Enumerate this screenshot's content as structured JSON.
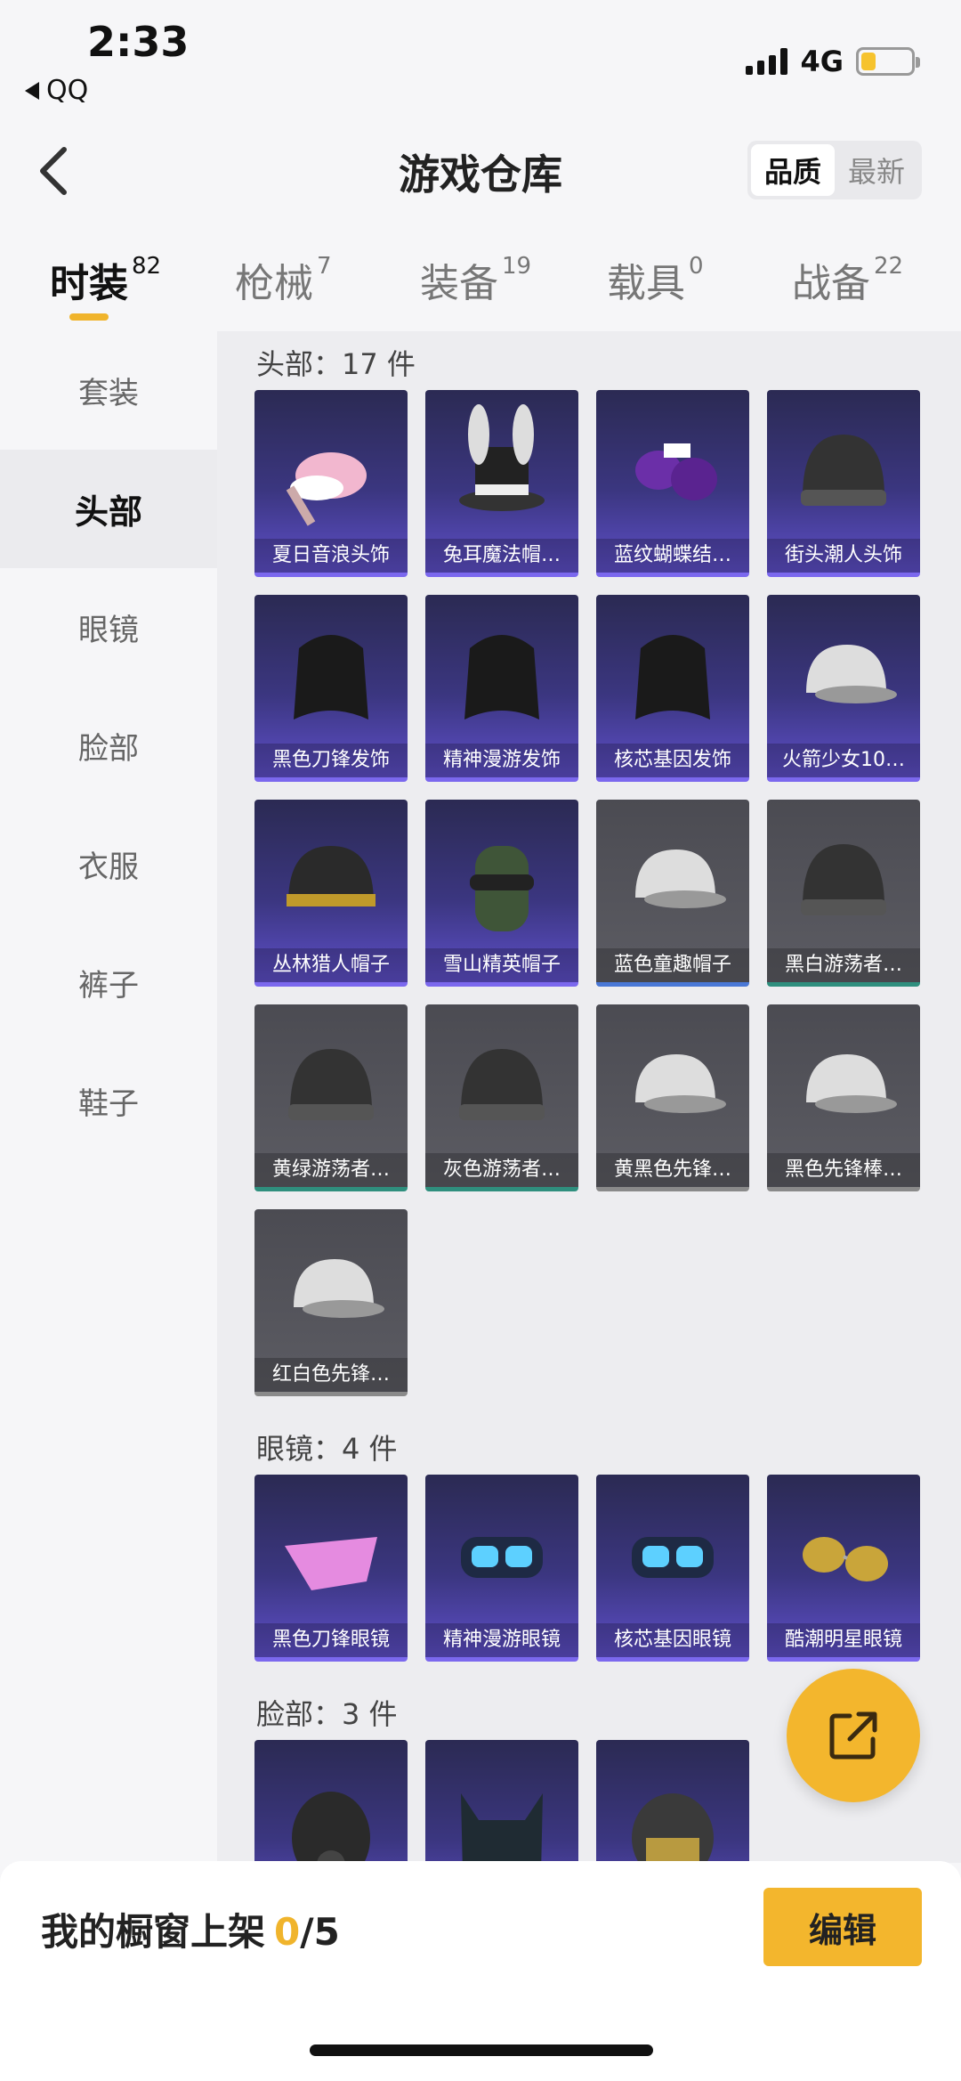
{
  "status_bar": {
    "time": "2:33",
    "back_app": "QQ",
    "network": "4G",
    "battery_level": 0.3
  },
  "nav": {
    "title": "游戏仓库",
    "sort_options": [
      "品质",
      "最新"
    ],
    "sort_active": "品质"
  },
  "categories": [
    {
      "label": "时装",
      "count": "82",
      "active": true
    },
    {
      "label": "枪械",
      "count": "7",
      "active": false
    },
    {
      "label": "装备",
      "count": "19",
      "active": false
    },
    {
      "label": "载具",
      "count": "0",
      "active": false
    },
    {
      "label": "战备",
      "count": "22",
      "active": false
    }
  ],
  "sidebar": {
    "items": [
      {
        "label": "套装"
      },
      {
        "label": "头部"
      },
      {
        "label": "眼镜"
      },
      {
        "label": "脸部"
      },
      {
        "label": "衣服"
      },
      {
        "label": "裤子"
      },
      {
        "label": "鞋子"
      }
    ],
    "active_index": 1
  },
  "sections": [
    {
      "title": "头部：17 件",
      "items": [
        {
          "name": "夏日音浪头饰",
          "rarity": "purple",
          "icon": "hat-icon"
        },
        {
          "name": "兔耳魔法帽…",
          "rarity": "purple",
          "icon": "top-hat-icon"
        },
        {
          "name": "蓝纹蝴蝶结…",
          "rarity": "purple",
          "icon": "bow-icon"
        },
        {
          "name": "街头潮人头饰",
          "rarity": "purple",
          "icon": "beanie-icon"
        },
        {
          "name": "黑色刀锋发饰",
          "rarity": "purple",
          "icon": "hair-icon"
        },
        {
          "name": "精神漫游发饰",
          "rarity": "purple",
          "icon": "hair-icon"
        },
        {
          "name": "核芯基因发饰",
          "rarity": "purple",
          "icon": "hair-icon"
        },
        {
          "name": "火箭少女10…",
          "rarity": "purple",
          "icon": "cap-icon"
        },
        {
          "name": "丛林猎人帽子",
          "rarity": "purple",
          "icon": "helmet-icon"
        },
        {
          "name": "雪山精英帽子",
          "rarity": "purple",
          "icon": "mask-hat-icon"
        },
        {
          "name": "蓝色童趣帽子",
          "rarity": "blue",
          "icon": "cap-icon"
        },
        {
          "name": "黑白游荡者…",
          "rarity": "teal",
          "icon": "beanie-icon"
        },
        {
          "name": "黄绿游荡者…",
          "rarity": "teal",
          "icon": "beanie-icon"
        },
        {
          "name": "灰色游荡者…",
          "rarity": "teal",
          "icon": "beanie-icon"
        },
        {
          "name": "黄黑色先锋…",
          "rarity": "gray",
          "icon": "cap-icon"
        },
        {
          "name": "黑色先锋棒…",
          "rarity": "gray",
          "icon": "cap-icon"
        },
        {
          "name": "红白色先锋…",
          "rarity": "gray",
          "icon": "cap-icon"
        }
      ]
    },
    {
      "title": "眼镜：4 件",
      "items": [
        {
          "name": "黑色刀锋眼镜",
          "rarity": "purple",
          "icon": "glasses-icon"
        },
        {
          "name": "精神漫游眼镜",
          "rarity": "purple",
          "icon": "goggles-icon"
        },
        {
          "name": "核芯基因眼镜",
          "rarity": "purple",
          "icon": "goggles-icon"
        },
        {
          "name": "酷潮明星眼镜",
          "rarity": "purple",
          "icon": "sunglasses-icon"
        }
      ]
    },
    {
      "title": "脸部：3 件",
      "items": [
        {
          "name": "",
          "rarity": "purple",
          "icon": "gas-mask-icon"
        },
        {
          "name": "",
          "rarity": "purple",
          "icon": "cat-mask-icon"
        },
        {
          "name": "",
          "rarity": "purple",
          "icon": "helmet-mask-icon"
        }
      ]
    }
  ],
  "bottom_bar": {
    "showcase_label": "我的橱窗上架",
    "showcase_current": "0",
    "showcase_total": "/5",
    "edit_label": "编辑"
  },
  "colors": {
    "accent": "#f3b62d",
    "purple_card": "#3b3680",
    "gray_card": "#55555c"
  }
}
